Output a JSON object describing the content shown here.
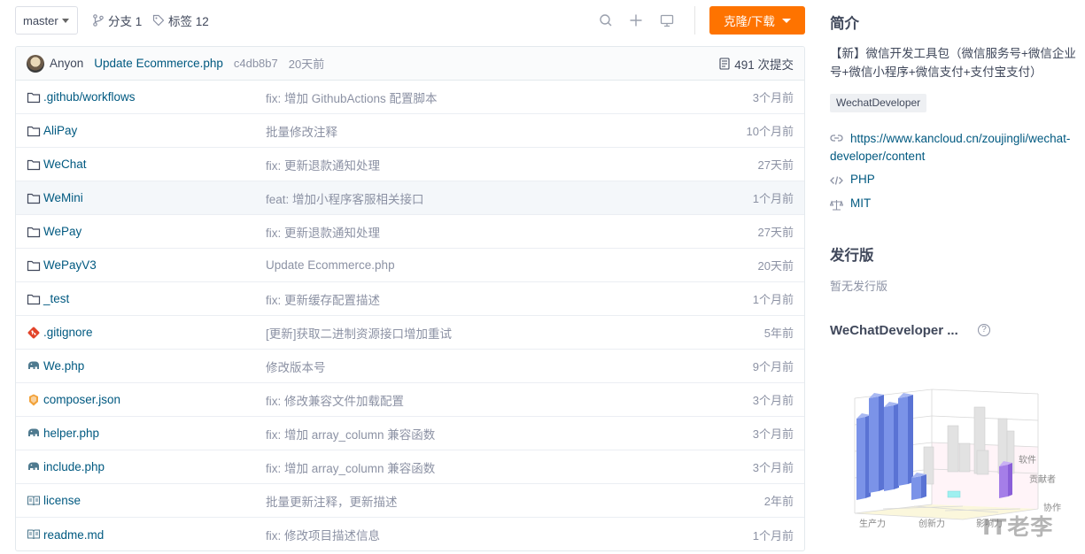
{
  "toolbar": {
    "branch": "master",
    "branches_label": "分支 1",
    "tags_label": "标签 12",
    "clone_label": "克隆/下载"
  },
  "commit": {
    "author": "Anyon",
    "message": "Update Ecommerce.php",
    "hash": "c4db8b7",
    "time": "20天前",
    "count_label": "491 次提交"
  },
  "files": [
    {
      "name": ".github/workflows",
      "icon": "folder-icon",
      "message": "fix: 增加 GithubActions 配置脚本",
      "time": "3个月前"
    },
    {
      "name": "AliPay",
      "icon": "folder-icon",
      "message": "批量修改注释",
      "time": "10个月前"
    },
    {
      "name": "WeChat",
      "icon": "folder-icon",
      "message": "fix: 更新退款通知处理",
      "time": "27天前"
    },
    {
      "name": "WeMini",
      "icon": "folder-icon",
      "message": "feat: 增加小程序客服相关接口",
      "time": "1个月前"
    },
    {
      "name": "WePay",
      "icon": "folder-icon",
      "message": "fix: 更新退款通知处理",
      "time": "27天前"
    },
    {
      "name": "WePayV3",
      "icon": "folder-icon",
      "message": "Update Ecommerce.php",
      "time": "20天前"
    },
    {
      "name": "_test",
      "icon": "folder-icon",
      "message": "fix: 更新缓存配置描述",
      "time": "1个月前"
    },
    {
      "name": ".gitignore",
      "icon": "git-icon",
      "message": "[更新]获取二进制资源接口增加重试",
      "time": "5年前"
    },
    {
      "name": "We.php",
      "icon": "php-elephant-icon",
      "message": "修改版本号",
      "time": "9个月前"
    },
    {
      "name": "composer.json",
      "icon": "composer-icon",
      "message": "fix: 修改兼容文件加载配置",
      "time": "3个月前"
    },
    {
      "name": "helper.php",
      "icon": "php-elephant-icon",
      "message": "fix: 增加 array_column 兼容函数",
      "time": "3个月前"
    },
    {
      "name": "include.php",
      "icon": "php-elephant-icon",
      "message": "fix: 增加 array_column 兼容函数",
      "time": "3个月前"
    },
    {
      "name": "license",
      "icon": "book-icon",
      "message": "批量更新注释，更新描述",
      "time": "2年前"
    },
    {
      "name": "readme.md",
      "icon": "book-icon",
      "message": "fix: 修改项目描述信息",
      "time": "1个月前"
    }
  ],
  "sidebar": {
    "intro_title": "简介",
    "description": "【新】微信开发工具包（微信服务号+微信企业号+微信小程序+微信支付+支付宝支付）",
    "tag": "WechatDeveloper",
    "url": "https://www.kancloud.cn/zoujingli/wechat-developer/content",
    "language": "PHP",
    "license": "MIT",
    "release_title": "发行版",
    "release_none": "暂无发行版",
    "gvp_title": "WeChatDeveloper ...",
    "help": "?",
    "axis_productivity": "生产力",
    "axis_innovation": "创新力",
    "axis_influence": "影响力",
    "axis_software": "软件",
    "axis_contributor": "贡献者",
    "axis_collab": "协作",
    "watermark": "IT老李"
  },
  "colors": {
    "accent": "#fe7300",
    "link": "#005980",
    "muted": "#8c92a4"
  }
}
